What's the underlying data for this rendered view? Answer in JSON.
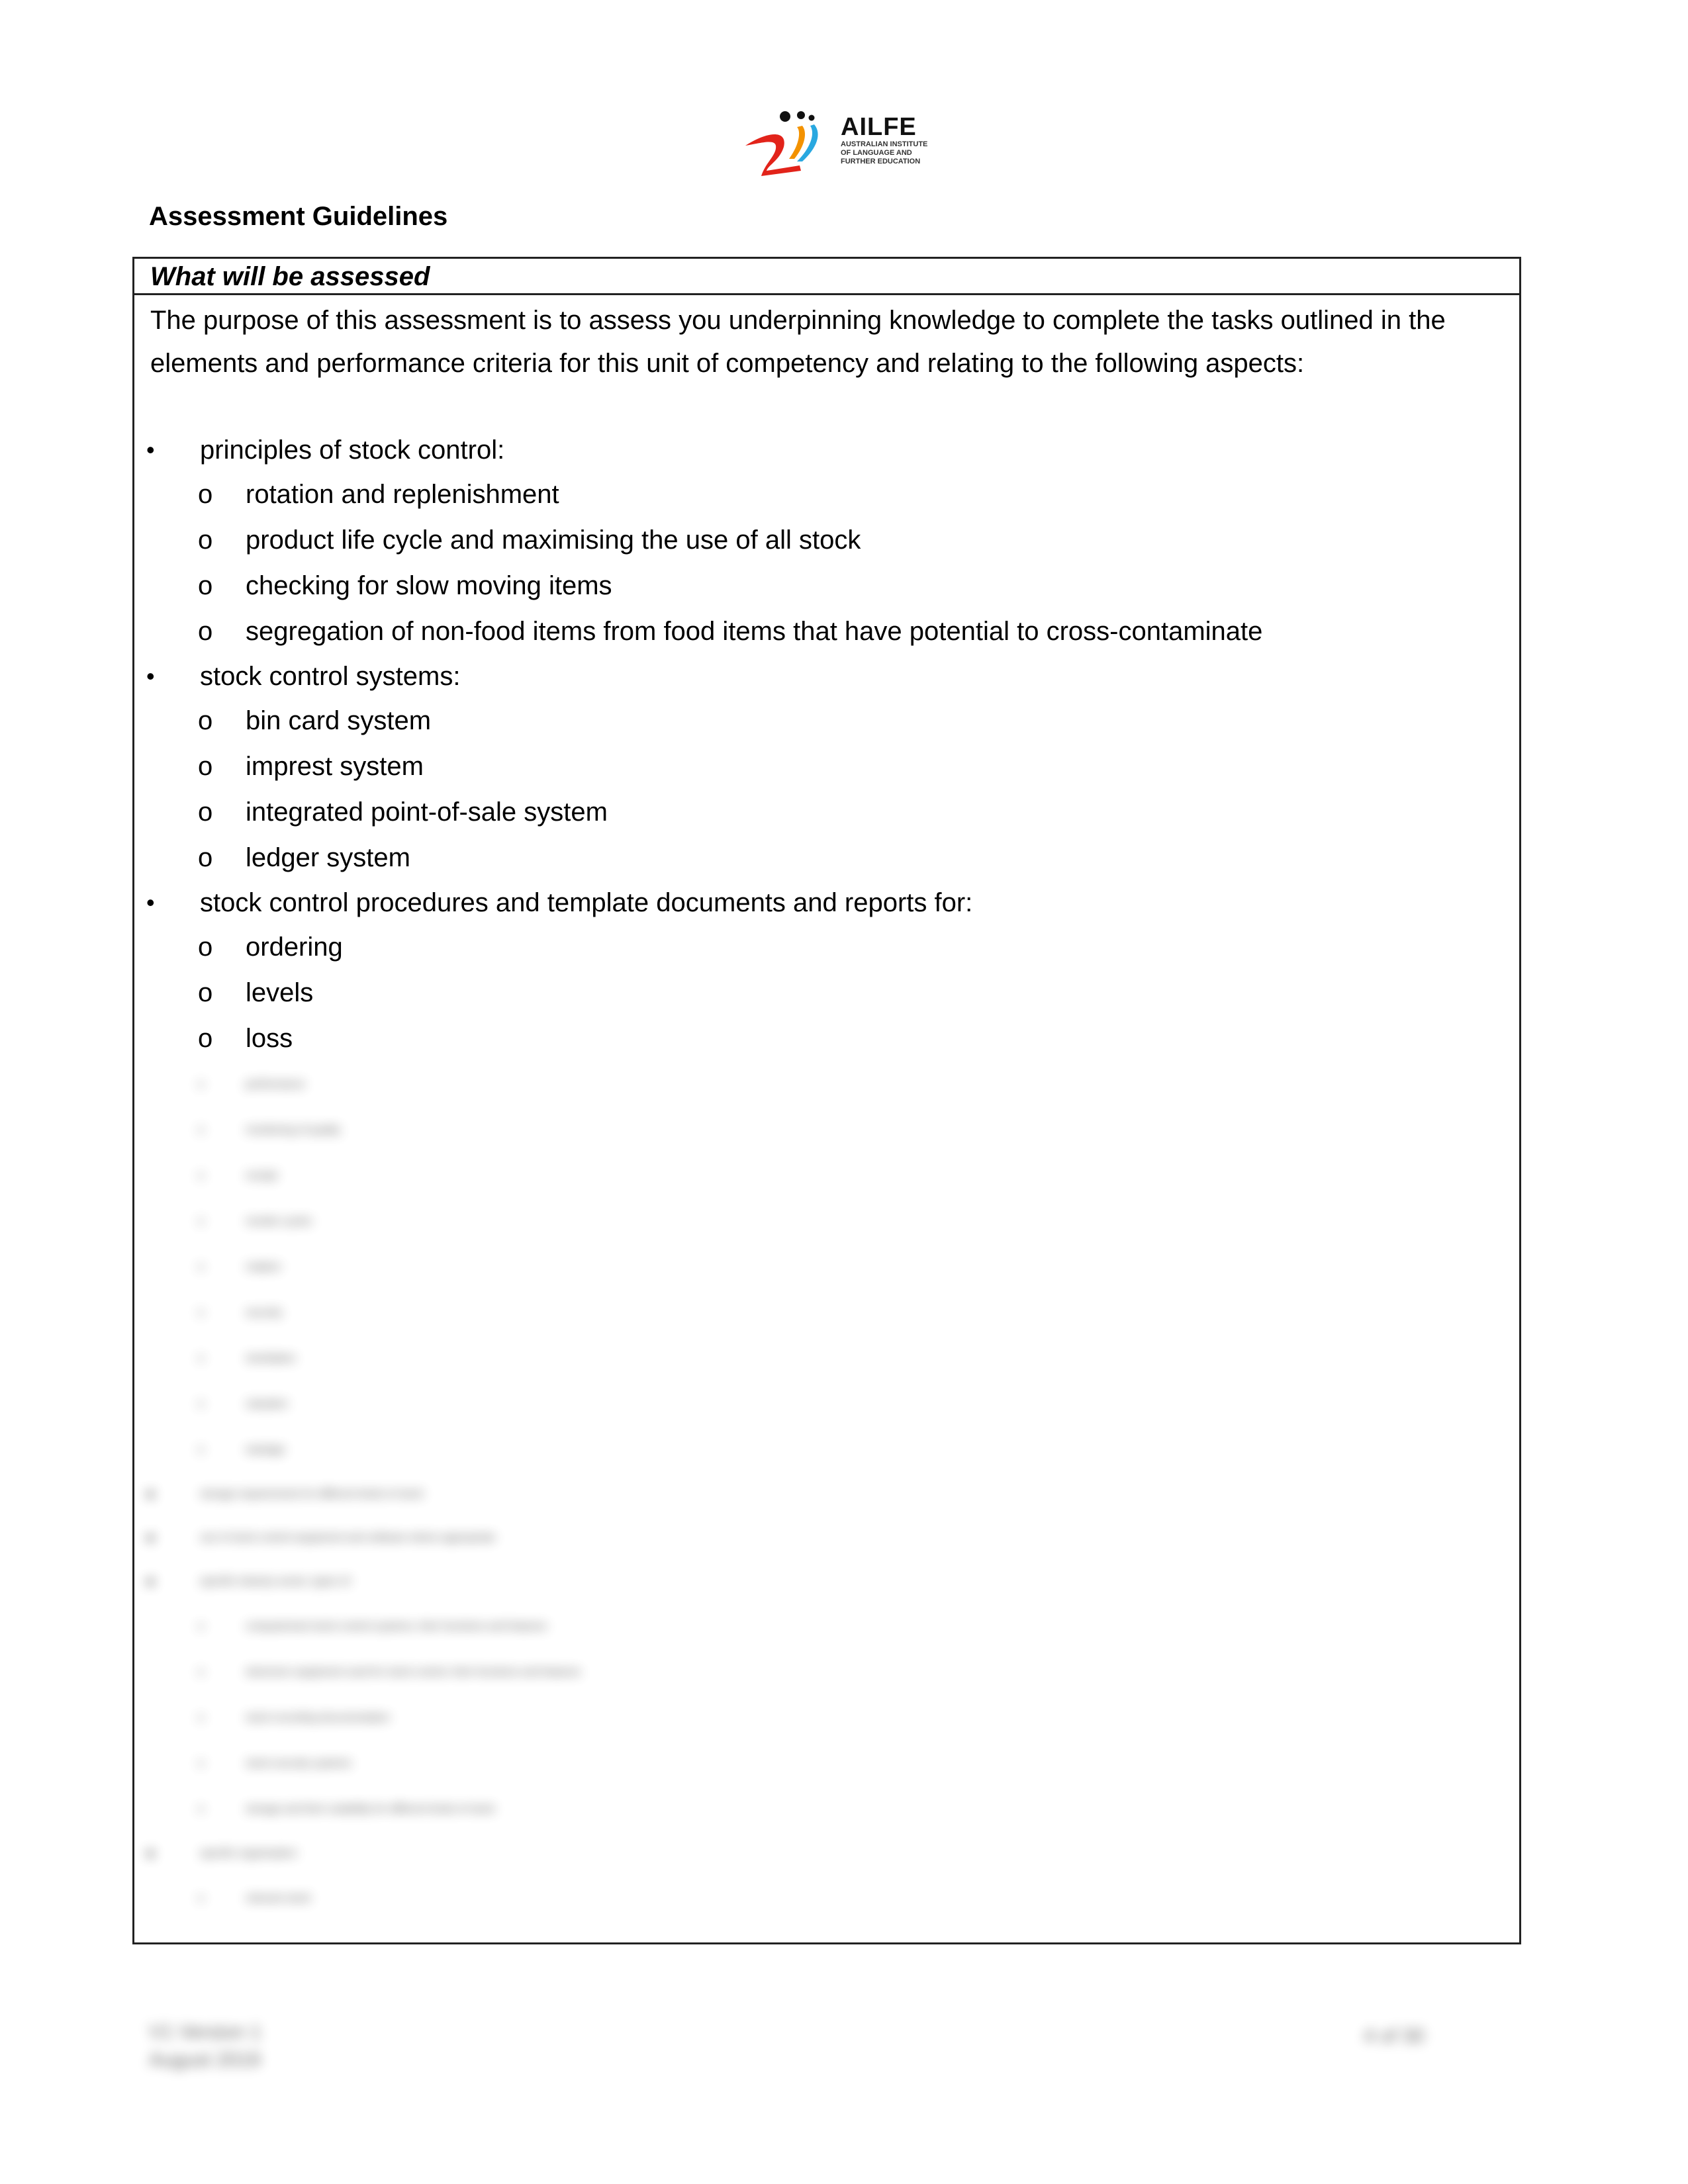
{
  "logo": {
    "brand": "AILFE",
    "subtitle_lines": [
      "AUSTRALIAN INSTITUTE",
      "OF LANGUAGE AND",
      "FURTHER EDUCATION"
    ],
    "colors": {
      "red": "#e2231a",
      "orange": "#f39200",
      "blue": "#29a8e0",
      "dark": "#111111"
    }
  },
  "heading": "Assessment Guidelines",
  "box": {
    "header": "What will be assessed",
    "intro": "The purpose of this assessment is to assess you underpinning knowledge to complete the tasks outlined in the elements and performance criteria for this unit of competency and relating to the following aspects:",
    "bullet_glyph": "•",
    "sub_glyph": "o",
    "items": [
      {
        "text": "principles of stock control:",
        "children": [
          "rotation and replenishment",
          "product life cycle and maximising the use of all stock",
          "checking for slow moving items",
          "segregation of non-food items from food items that have potential to cross-contaminate"
        ]
      },
      {
        "text": "stock control systems:",
        "children": [
          "bin card system",
          "imprest system",
          "integrated point-of-sale system",
          "ledger system"
        ]
      },
      {
        "text": "stock control procedures and template documents and reports for:",
        "children": [
          "ordering",
          "levels",
          "loss"
        ]
      }
    ],
    "blurred_items": [
      {
        "level": 2,
        "text": "performance"
      },
      {
        "level": 2,
        "text": "monitoring of quality"
      },
      {
        "level": 2,
        "text": "receipt"
      },
      {
        "level": 2,
        "text": "reorder cycles"
      },
      {
        "level": 2,
        "text": "rotation"
      },
      {
        "level": 2,
        "text": "security"
      },
      {
        "level": 2,
        "text": "stocktakes"
      },
      {
        "level": 2,
        "text": "valuation"
      },
      {
        "level": 2,
        "text": "wastage"
      },
      {
        "level": 1,
        "text": "storage requirements for different kinds of stock"
      },
      {
        "level": 1,
        "text": "use of stock control equipment and software where appropriate"
      },
      {
        "level": 1,
        "text": "specific industry sector, types of:"
      },
      {
        "level": 2,
        "text": "computerised stock control systems, their functions and features"
      },
      {
        "level": 2,
        "text": "electronic equipment used for stock control, their functions and features"
      },
      {
        "level": 2,
        "text": "stock recording documentation"
      },
      {
        "level": 2,
        "text": "stock security systems"
      },
      {
        "level": 2,
        "text": "storage and their suitability for different kinds of stock"
      },
      {
        "level": 1,
        "text": "specific organisation:"
      },
      {
        "level": 2,
        "text": "relevant stock"
      }
    ]
  },
  "footer": {
    "left_lines": [
      "V1 Version 1",
      "August 2019"
    ],
    "right": "4 of 30"
  }
}
